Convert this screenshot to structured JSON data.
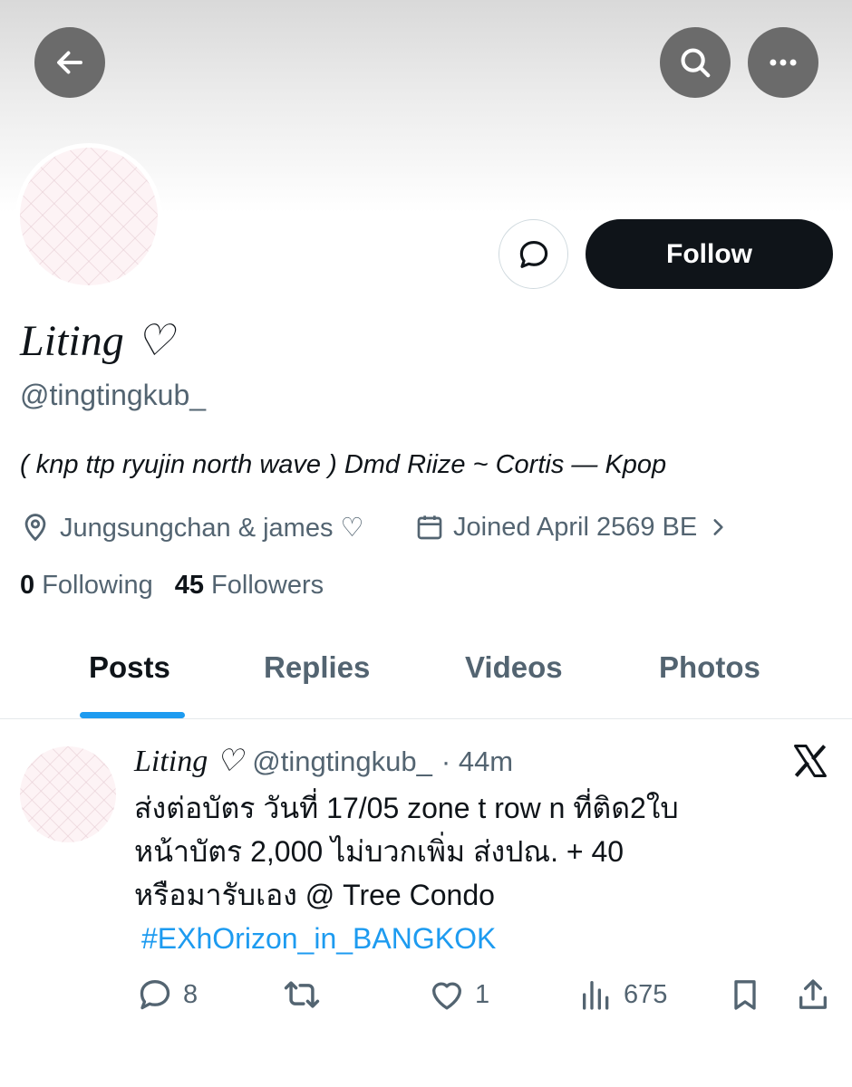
{
  "profile": {
    "display_name": "Liting ♡",
    "handle": "@tingtingkub_",
    "bio": "( knp ttp ryujin north wave ) Dmd Riize ~ Cortis — Kpop",
    "location": "Jungsungchan & james ♡",
    "joined": "Joined April 2569 BE",
    "following_count": "0",
    "following_label": "Following",
    "followers_count": "45",
    "followers_label": "Followers"
  },
  "buttons": {
    "follow_label": "Follow"
  },
  "tabs": [
    {
      "label": "Posts",
      "active": true
    },
    {
      "label": "Replies",
      "active": false
    },
    {
      "label": "Videos",
      "active": false
    },
    {
      "label": "Photos",
      "active": false
    }
  ],
  "post": {
    "author_name": "Liting ♡",
    "author_handle": "@tingtingkub_",
    "time": "· 44m",
    "text_lines": [
      "ส่งต่อบัตร วันที่ 17/05 zone t row n ที่ติด2ใบ",
      "หน้าบัตร 2,000 ไม่บวกเพิ่ม ส่งปณ. + 40",
      "หรือมารับเอง @ Tree Condo"
    ],
    "hashtag": "#EXhOrizon_in_BANGKOK",
    "replies": "8",
    "reposts": "",
    "likes": "1",
    "views": "675"
  },
  "icons": [
    "back-arrow-icon",
    "search-icon",
    "more-icon",
    "message-icon",
    "location-icon",
    "calendar-icon",
    "chevron-right-icon",
    "x-logo-icon",
    "reply-icon",
    "repost-icon",
    "like-icon",
    "views-icon",
    "bookmark-icon",
    "share-icon"
  ],
  "colors": {
    "accent": "#1d9bf0",
    "text_primary": "#0f1419",
    "text_secondary": "#536471",
    "follow_bg": "#0f1419",
    "top_button_bg": "#6b6b6b"
  }
}
